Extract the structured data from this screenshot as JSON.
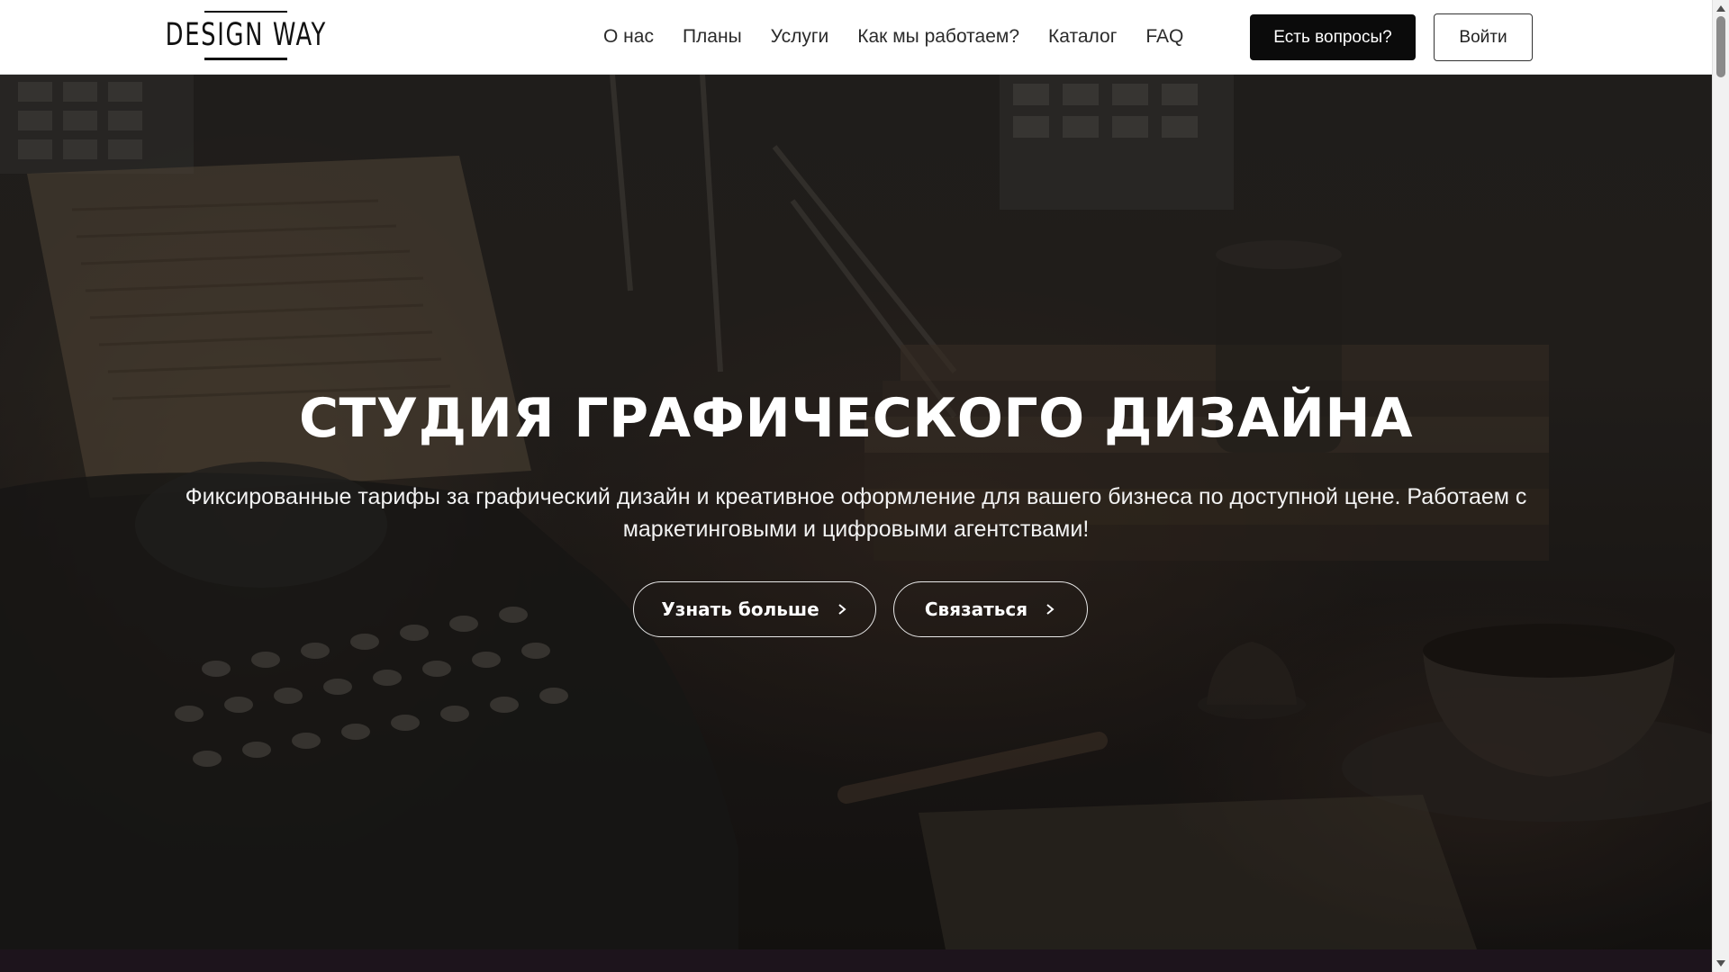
{
  "header": {
    "logo_text": "DESIGN WAY",
    "nav": [
      {
        "label": "О нас"
      },
      {
        "label": "Планы"
      },
      {
        "label": "Услуги"
      },
      {
        "label": "Как мы работаем?"
      },
      {
        "label": "Каталог"
      },
      {
        "label": "FAQ"
      }
    ],
    "questions_button": "Есть вопросы?",
    "login_button": "Войти"
  },
  "hero": {
    "title": "СТУДИЯ ГРАФИЧЕСКОГО ДИЗАЙНА",
    "subtitle": "Фиксированные тарифы за графический дизайн и креативное оформление для вашего бизнеса по доступной цене. Работаем с маркетинговыми и цифровыми агентствами!",
    "learn_more_button": "Узнать больше",
    "contact_button": "Связаться"
  },
  "colors": {
    "header_bg": "#ffffff",
    "primary_button": "#0b0b0b",
    "hero_text": "#ffffff",
    "bottom_strip": "#1d141c"
  },
  "icons": {
    "button_chevron": "chevron-right-icon"
  }
}
